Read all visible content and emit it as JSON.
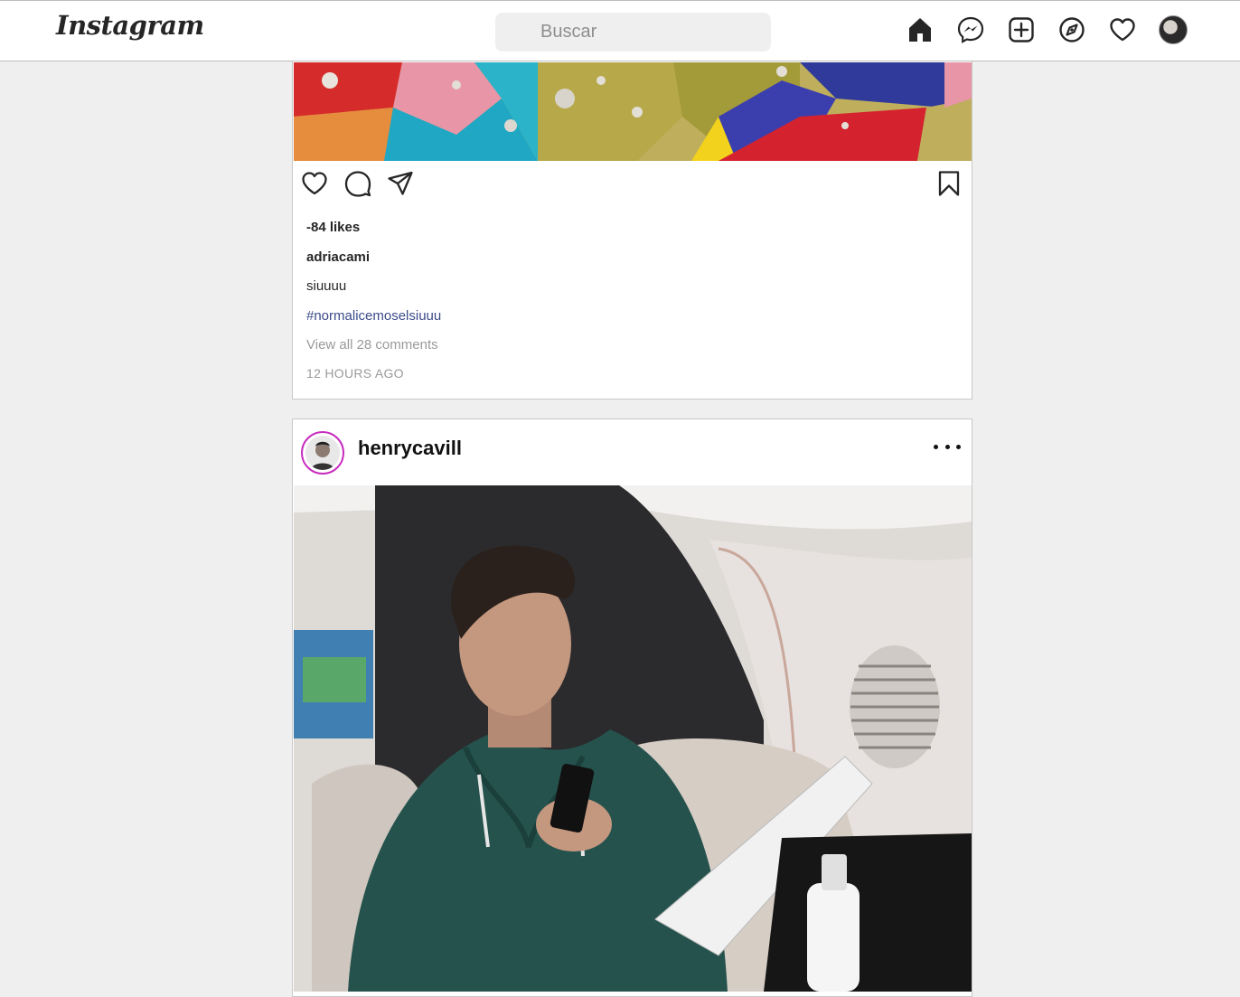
{
  "header": {
    "logo": "Instagram",
    "search_placeholder": "Buscar",
    "nav": [
      "home-icon",
      "messenger-icon",
      "new-post-icon",
      "explore-icon",
      "activity-heart-icon",
      "profile-avatar"
    ]
  },
  "posts": [
    {
      "likes": "-84 likes",
      "username": "adriacami",
      "caption": "siuuuu",
      "hashtag": "#normalicemoselsiuuu",
      "comments": "View all 28 comments",
      "time": "12 HOURS AGO"
    },
    {
      "username": "henrycavill"
    }
  ],
  "colors": {
    "background": "#efefef",
    "story_ring": "#c82dbe",
    "hashtag": "#3b4b8a",
    "muted": "#9a9a9a"
  }
}
